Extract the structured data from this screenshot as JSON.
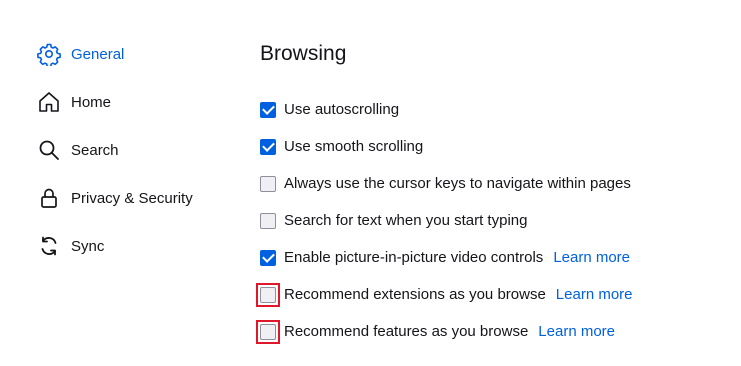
{
  "sidebar": {
    "items": [
      {
        "label": "General",
        "icon": "gear-icon",
        "active": true
      },
      {
        "label": "Home",
        "icon": "home-icon",
        "active": false
      },
      {
        "label": "Search",
        "icon": "search-icon",
        "active": false
      },
      {
        "label": "Privacy & Security",
        "icon": "lock-icon",
        "active": false
      },
      {
        "label": "Sync",
        "icon": "sync-icon",
        "active": false
      }
    ]
  },
  "main": {
    "section_title": "Browsing",
    "options": [
      {
        "label": "Use autoscrolling",
        "checked": true,
        "highlighted": false,
        "link": ""
      },
      {
        "label": "Use smooth scrolling",
        "checked": true,
        "highlighted": false,
        "link": ""
      },
      {
        "label": "Always use the cursor keys to navigate within pages",
        "checked": false,
        "highlighted": false,
        "link": ""
      },
      {
        "label": "Search for text when you start typing",
        "checked": false,
        "highlighted": false,
        "link": ""
      },
      {
        "label": "Enable picture-in-picture video controls",
        "checked": true,
        "highlighted": false,
        "link": "Learn more"
      },
      {
        "label": "Recommend extensions as you browse",
        "checked": false,
        "highlighted": true,
        "link": "Learn more"
      },
      {
        "label": "Recommend features as you browse",
        "checked": false,
        "highlighted": true,
        "link": "Learn more"
      }
    ]
  },
  "colors": {
    "accent": "#0061e0",
    "highlight_border": "#e0162b"
  }
}
